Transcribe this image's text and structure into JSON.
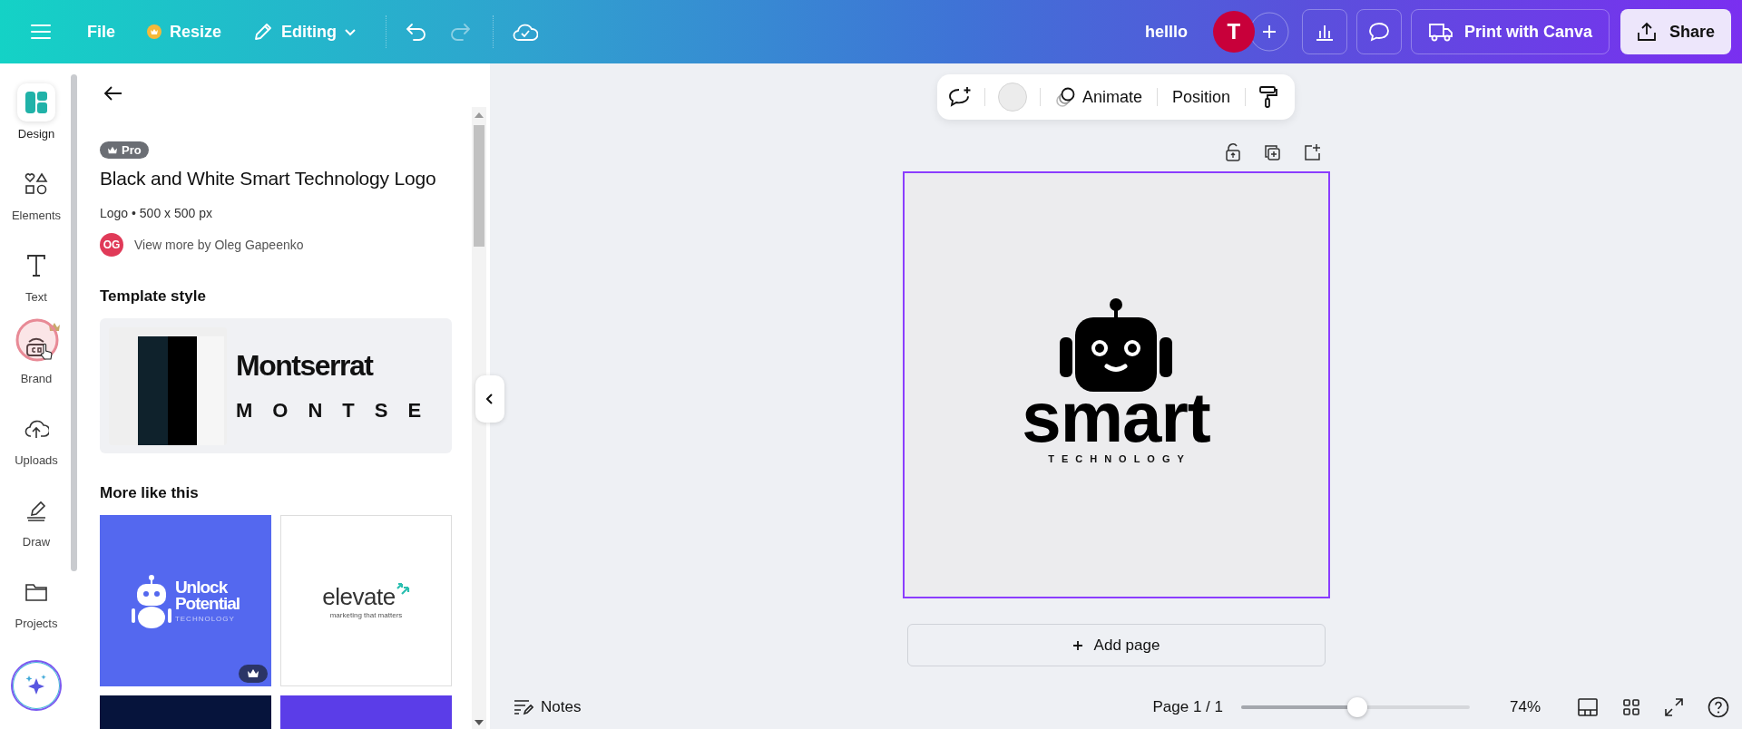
{
  "topbar": {
    "file": "File",
    "resize": "Resize",
    "mode": "Editing",
    "title": "helllo",
    "avatar": "T",
    "print": "Print with Canva",
    "share": "Share"
  },
  "rail": [
    {
      "label": "Design",
      "selected": true,
      "pro": false
    },
    {
      "label": "Elements",
      "selected": false,
      "pro": false
    },
    {
      "label": "Text",
      "selected": false,
      "pro": false
    },
    {
      "label": "Brand",
      "selected": false,
      "pro": true
    },
    {
      "label": "Uploads",
      "selected": false,
      "pro": false
    },
    {
      "label": "Draw",
      "selected": false,
      "pro": false
    },
    {
      "label": "Projects",
      "selected": false,
      "pro": false
    }
  ],
  "panel": {
    "badge": "Pro",
    "title": "Black and White Smart Technology Logo",
    "meta": "Logo • 500 x 500 px",
    "author_initials": "OG",
    "author_link": "View more by Oleg Gapeenko",
    "style_heading": "Template style",
    "font_name": "Montserrat",
    "font_sample": "MONTSE",
    "more_heading": "More like this",
    "templates": [
      {
        "kind": "robot",
        "color": "#5468ef",
        "lines": [
          "Unlock",
          "Potential"
        ],
        "tagline": "TECHNOLOGY",
        "pro": true
      },
      {
        "kind": "wordmark",
        "color": "#ffffff",
        "lines": [
          "elevate"
        ],
        "tagline": "marketing that matters",
        "pro": false
      },
      {
        "kind": "plain",
        "color": "#06143c"
      },
      {
        "kind": "plain",
        "color": "#5b3de8"
      }
    ]
  },
  "toolbar": {
    "animate": "Animate",
    "position": "Position"
  },
  "design": {
    "wordmark": "smart",
    "tagline": "TECHNOLOGY"
  },
  "add_page": "Add page",
  "status": {
    "notes": "Notes",
    "page": "Page 1 / 1",
    "zoom": {
      "level": 0.51
    },
    "zoom_reading": "74%"
  }
}
